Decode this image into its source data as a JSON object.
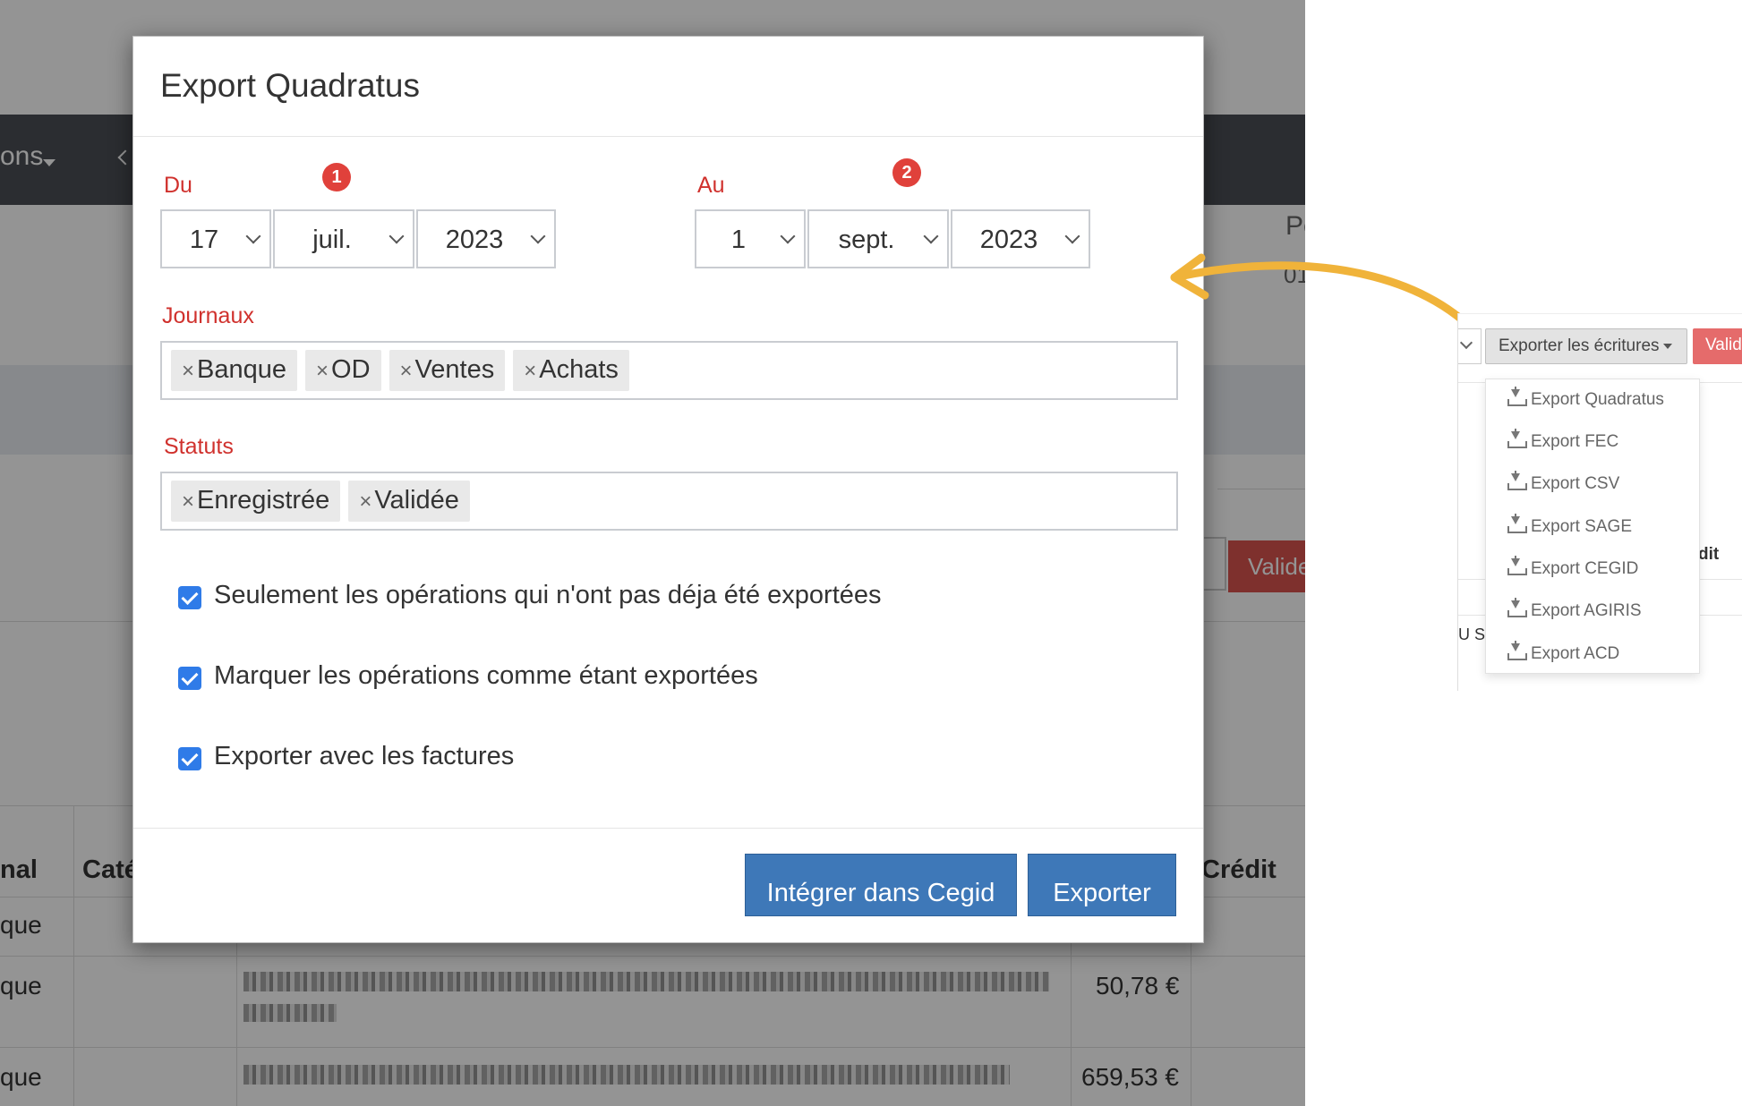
{
  "background": {
    "nav_text": "ons",
    "pe": "Pe",
    "zero_one": "01",
    "valide_label": "Valide",
    "table_headers": {
      "journal": "nal",
      "categorie": "Caté",
      "credit": "Crédit"
    },
    "rows": [
      {
        "journal": "que",
        "amount": ""
      },
      {
        "journal": "que",
        "amount": "50,78 €"
      },
      {
        "journal": "que",
        "amount": "659,53 €"
      }
    ]
  },
  "modal": {
    "title": "Export Quadratus",
    "from": {
      "label": "Du",
      "badge": "1",
      "day": "17",
      "month": "juil.",
      "year": "2023"
    },
    "to": {
      "label": "Au",
      "badge": "2",
      "day": "1",
      "month": "sept.",
      "year": "2023"
    },
    "journaux": {
      "label": "Journaux",
      "tags": [
        "Banque",
        "OD",
        "Ventes",
        "Achats"
      ]
    },
    "statuts": {
      "label": "Statuts",
      "tags": [
        "Enregistrée",
        "Validée"
      ]
    },
    "remove_glyph": "×",
    "checkboxes": [
      {
        "label": "Seulement les opérations qui n'ont pas déja été exportées",
        "checked": true
      },
      {
        "label": "Marquer les opérations comme étant exportées",
        "checked": true
      },
      {
        "label": "Exporter avec les factures",
        "checked": true
      }
    ],
    "buttons": {
      "cegid": "Intégrer dans Cegid",
      "export": "Exporter"
    }
  },
  "inset": {
    "export_button": "Exporter les écritures",
    "red_button": "Valide",
    "menu": [
      "Export Quadratus",
      "Export FEC",
      "Export CSV",
      "Export SAGE",
      "Export CEGID",
      "Export AGIRIS",
      "Export ACD"
    ],
    "credit_fragment": "dit",
    "row_fragment": "U S"
  },
  "colors": {
    "label_red": "#d0312d",
    "badge_red": "#e0413b",
    "primary_blue": "#3e78b8",
    "checkbox_blue": "#2f7be8",
    "arrow_orange": "#f0b33a"
  },
  "icons": {
    "select_chevron": "chevron-down-icon",
    "remove_tag": "close-icon",
    "menu_item": "download-icon",
    "arrow": "curved-arrow-icon"
  }
}
